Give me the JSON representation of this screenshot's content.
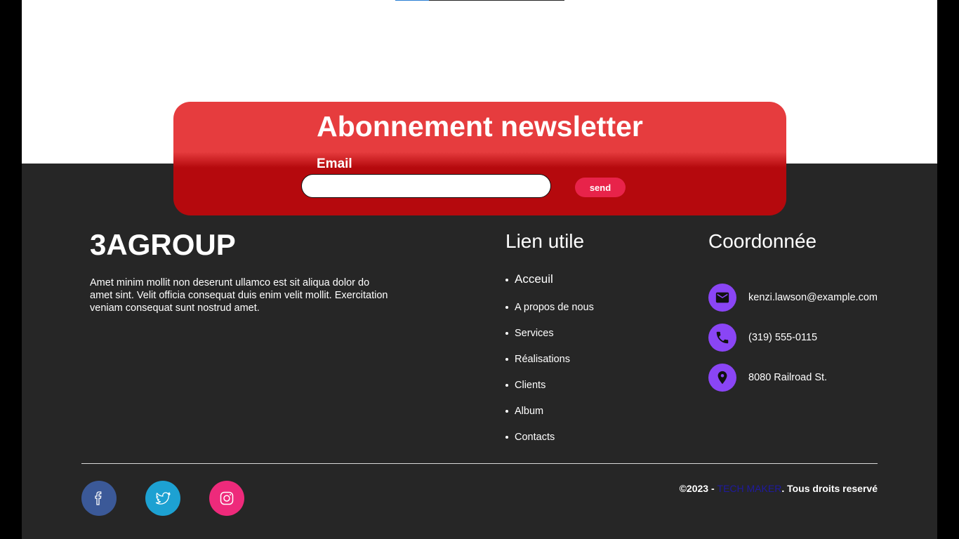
{
  "newsletter": {
    "title": "Abonnement newsletter",
    "email_label": "Email",
    "email_value": "",
    "send_label": "send"
  },
  "brand": {
    "name": "3AGROUP",
    "description": "Amet minim mollit non deserunt ullamco est sit aliqua dolor do amet sint. Velit officia consequat duis enim velit mollit. Exercitation veniam consequat sunt nostrud amet."
  },
  "links": {
    "title": "Lien utile",
    "items": [
      "Acceuil",
      "A propos de nous",
      "Services",
      "Réalisations",
      "Clients",
      "Album",
      "Contacts"
    ]
  },
  "contact": {
    "title": "Coordonnée",
    "email": "kenzi.lawson@example.com",
    "phone": "(319) 555-0115",
    "address": "8080 Railroad St."
  },
  "social": {
    "facebook": "facebook-icon",
    "twitter": "twitter-icon",
    "instagram": "instagram-icon"
  },
  "footer": {
    "copyright_prefix": "©2023 - ",
    "copyright_brand": "TECH MAKER",
    "copyright_suffix": ". Tous droits reservé"
  },
  "colors": {
    "footer_bg": "#262626",
    "newsletter_red": "#e63c3e",
    "send_button": "#e8234a",
    "contact_icon": "#8a45f5",
    "facebook": "#3b5998",
    "twitter": "#1da1d2",
    "instagram": "#ee2a7b",
    "copyright_accent": "#1f1a9e"
  }
}
